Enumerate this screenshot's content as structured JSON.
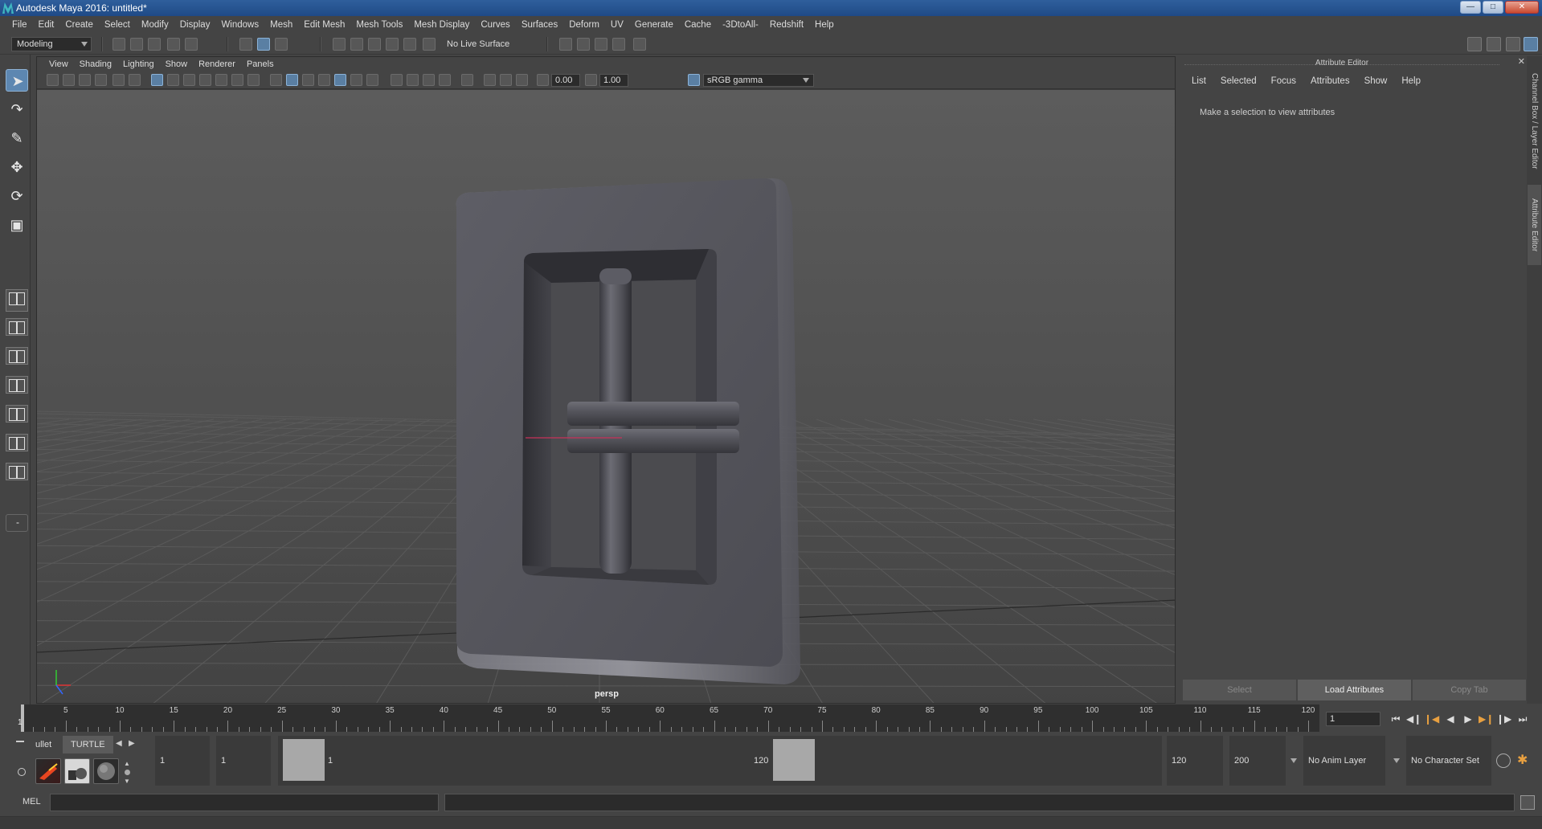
{
  "window": {
    "title": "Autodesk Maya 2016: untitled*"
  },
  "menubar": [
    "File",
    "Edit",
    "Create",
    "Select",
    "Modify",
    "Display",
    "Windows",
    "Mesh",
    "Edit Mesh",
    "Mesh Tools",
    "Mesh Display",
    "Curves",
    "Surfaces",
    "Deform",
    "UV",
    "Generate",
    "Cache",
    "-3DtoAll-",
    "Redshift",
    "Help"
  ],
  "statusline": {
    "mode": "Modeling",
    "live_surface": "No Live Surface"
  },
  "viewport": {
    "menu": [
      "View",
      "Shading",
      "Lighting",
      "Show",
      "Renderer",
      "Panels"
    ],
    "exposure": "0.00",
    "gamma": "1.00",
    "color_space": "sRGB gamma",
    "camera": "persp",
    "grid_color": "#5a5a5a",
    "object": "belt-buckle"
  },
  "attribute_editor": {
    "title": "Attribute Editor",
    "menu": [
      "List",
      "Selected",
      "Focus",
      "Attributes",
      "Show",
      "Help"
    ],
    "message": "Make a selection to view attributes",
    "buttons": {
      "select": "Select",
      "load": "Load Attributes",
      "copy": "Copy Tab"
    },
    "side_tabs": [
      "Channel Box / Layer Editor",
      "Attribute Editor"
    ]
  },
  "time_slider": {
    "ticks": [
      "5",
      "10",
      "15",
      "20",
      "25",
      "30",
      "35",
      "40",
      "45",
      "50",
      "55",
      "60",
      "65",
      "70",
      "75",
      "80",
      "85",
      "90",
      "95",
      "100",
      "105",
      "110",
      "115",
      "120"
    ],
    "current_frame": "1",
    "current_frame_field": "1"
  },
  "range": {
    "shelf_tabs": [
      "ullet",
      "TURTLE"
    ],
    "start_time": "1",
    "playback_start": "1",
    "range_start": "1",
    "range_end": "120",
    "playback_end": "120",
    "end_time": "200",
    "anim_layer": "No Anim Layer",
    "character_set": "No Character Set"
  },
  "command_line": {
    "label": "MEL"
  }
}
